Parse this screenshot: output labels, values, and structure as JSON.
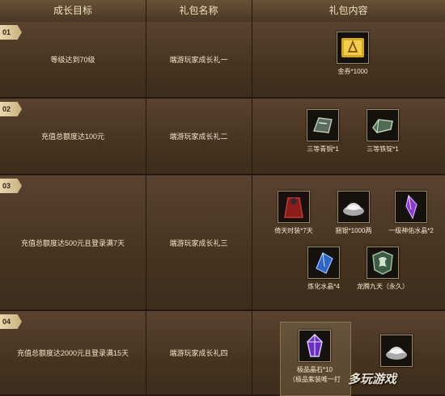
{
  "header": {
    "col1": "成长目标",
    "col2": "礼包名称",
    "col3": "礼包内容"
  },
  "rows": [
    {
      "num": "01",
      "goal": "等级达到70级",
      "pack": "端游玩家成长礼一",
      "items": [
        {
          "icon": "gold-ticket-icon",
          "label": "金券*1000"
        }
      ]
    },
    {
      "num": "02",
      "goal": "充值总额度达100元",
      "pack": "端游玩家成长礼二",
      "items": [
        {
          "icon": "bronze-bar-icon",
          "label": "三等青铜*1"
        },
        {
          "icon": "iron-ingot-icon",
          "label": "三等铁锭*1"
        }
      ]
    },
    {
      "num": "03",
      "goal": "充值总额度达500元且登录满7天",
      "pack": "端游玩家成长礼三",
      "items": [
        {
          "icon": "costume-icon",
          "label": "倚天时装*7天"
        },
        {
          "icon": "silver-ingot-icon",
          "label": "捆银*1000两"
        },
        {
          "icon": "purple-crystal-icon",
          "label": "一级神佑水晶*2"
        },
        {
          "icon": "blue-crystal-icon",
          "label": "炼化水晶*4"
        },
        {
          "icon": "dragon-token-icon",
          "label": "龙腾九天（永久）"
        }
      ]
    },
    {
      "num": "04",
      "goal": "充值总额度达2000元且登录满15天",
      "pack": "端游玩家成长礼四",
      "items": [
        {
          "icon": "premium-gem-icon",
          "label": "极品晶石*10",
          "sublabel": "（极品紫装唯一打"
        },
        {
          "icon": "silver-ingot-icon",
          "label": ""
        }
      ]
    }
  ],
  "watermark": "多玩游戏"
}
